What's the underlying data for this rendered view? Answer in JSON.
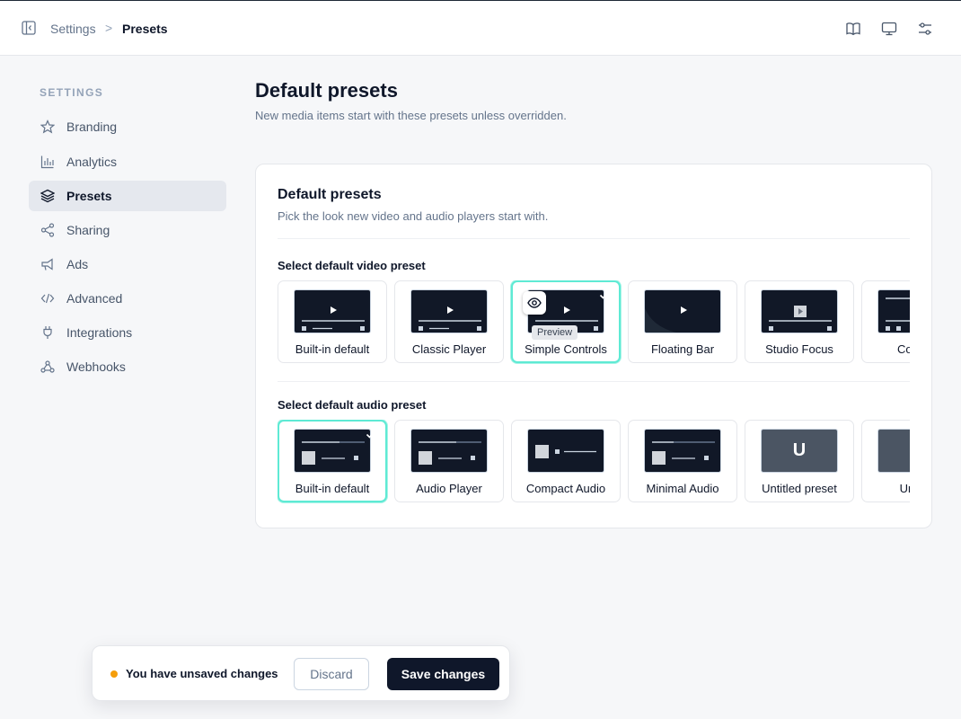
{
  "breadcrumb": {
    "root": "Settings",
    "separator": ">",
    "current": "Presets"
  },
  "header_icons": [
    "book-icon",
    "monitor-icon",
    "sliders-icon"
  ],
  "sidebar": {
    "heading": "SETTINGS",
    "items": [
      {
        "label": "Branding",
        "icon": "star-icon",
        "active": false
      },
      {
        "label": "Analytics",
        "icon": "bar-chart-icon",
        "active": false
      },
      {
        "label": "Presets",
        "icon": "layers-icon",
        "active": true
      },
      {
        "label": "Sharing",
        "icon": "share-icon",
        "active": false
      },
      {
        "label": "Ads",
        "icon": "megaphone-icon",
        "active": false
      },
      {
        "label": "Advanced",
        "icon": "code-icon",
        "active": false
      },
      {
        "label": "Integrations",
        "icon": "plug-icon",
        "active": false
      },
      {
        "label": "Webhooks",
        "icon": "webhook-icon",
        "active": false
      }
    ]
  },
  "page": {
    "title": "Default presets",
    "subtitle": "New media items start with these presets unless overridden."
  },
  "card": {
    "title": "Default presets",
    "subtitle": "Pick the look new video and audio players start with.",
    "video_label": "Select default video preset",
    "audio_label": "Select default audio preset",
    "video_presets": [
      {
        "label": "Built-in default",
        "selected": false
      },
      {
        "label": "Classic Player",
        "selected": false
      },
      {
        "label": "Simple Controls",
        "selected": true
      },
      {
        "label": "Floating Bar",
        "selected": false
      },
      {
        "label": "Studio Focus",
        "selected": false
      },
      {
        "label": "Compa",
        "selected": false
      }
    ],
    "audio_presets": [
      {
        "label": "Built-in default",
        "selected": true
      },
      {
        "label": "Audio Player",
        "selected": false
      },
      {
        "label": "Compact Audio",
        "selected": false
      },
      {
        "label": "Minimal Audio",
        "selected": false
      },
      {
        "label": "Untitled preset",
        "selected": false,
        "letter": "U"
      },
      {
        "label": "Untitle",
        "selected": false
      }
    ],
    "preview_tooltip": "Preview"
  },
  "unsaved_bar": {
    "message": "You have unsaved changes",
    "discard": "Discard",
    "save": "Save changes"
  },
  "colors": {
    "accent_selected": "#5eead4",
    "warning_dot": "#f59e0b",
    "primary_button": "#0f172a"
  }
}
